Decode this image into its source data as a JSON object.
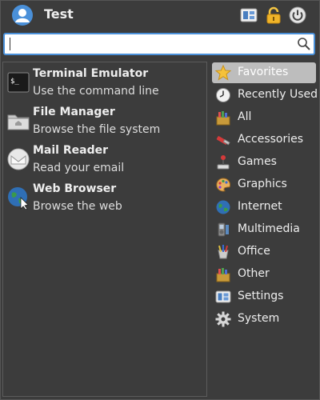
{
  "header": {
    "user_name": "Test",
    "buttons": [
      "settings-manager-icon",
      "lock-icon",
      "power-icon"
    ]
  },
  "search": {
    "value": "",
    "placeholder": ""
  },
  "favorites": [
    {
      "name": "Terminal Emulator",
      "description": "Use the command line",
      "icon": "terminal-icon"
    },
    {
      "name": "File Manager",
      "description": "Browse the file system",
      "icon": "folder-icon"
    },
    {
      "name": "Mail Reader",
      "description": "Read your email",
      "icon": "mail-icon"
    },
    {
      "name": "Web Browser",
      "description": "Browse the web",
      "icon": "globe-icon"
    }
  ],
  "categories": [
    {
      "label": "Favorites",
      "icon": "star-icon",
      "selected": true
    },
    {
      "label": "Recently Used",
      "icon": "clock-icon"
    },
    {
      "label": "All",
      "icon": "all-icon"
    },
    {
      "label": "Accessories",
      "icon": "accessories-icon"
    },
    {
      "label": "Games",
      "icon": "joystick-icon"
    },
    {
      "label": "Graphics",
      "icon": "palette-icon"
    },
    {
      "label": "Internet",
      "icon": "globe-icon"
    },
    {
      "label": "Multimedia",
      "icon": "multimedia-icon"
    },
    {
      "label": "Office",
      "icon": "office-icon"
    },
    {
      "label": "Other",
      "icon": "other-icon"
    },
    {
      "label": "Settings",
      "icon": "settings-icon"
    },
    {
      "label": "System",
      "icon": "gear-icon"
    }
  ],
  "colors": {
    "background": "#3c3c3c",
    "selected": "#bdbdbd",
    "accent": "#4a90d9"
  }
}
